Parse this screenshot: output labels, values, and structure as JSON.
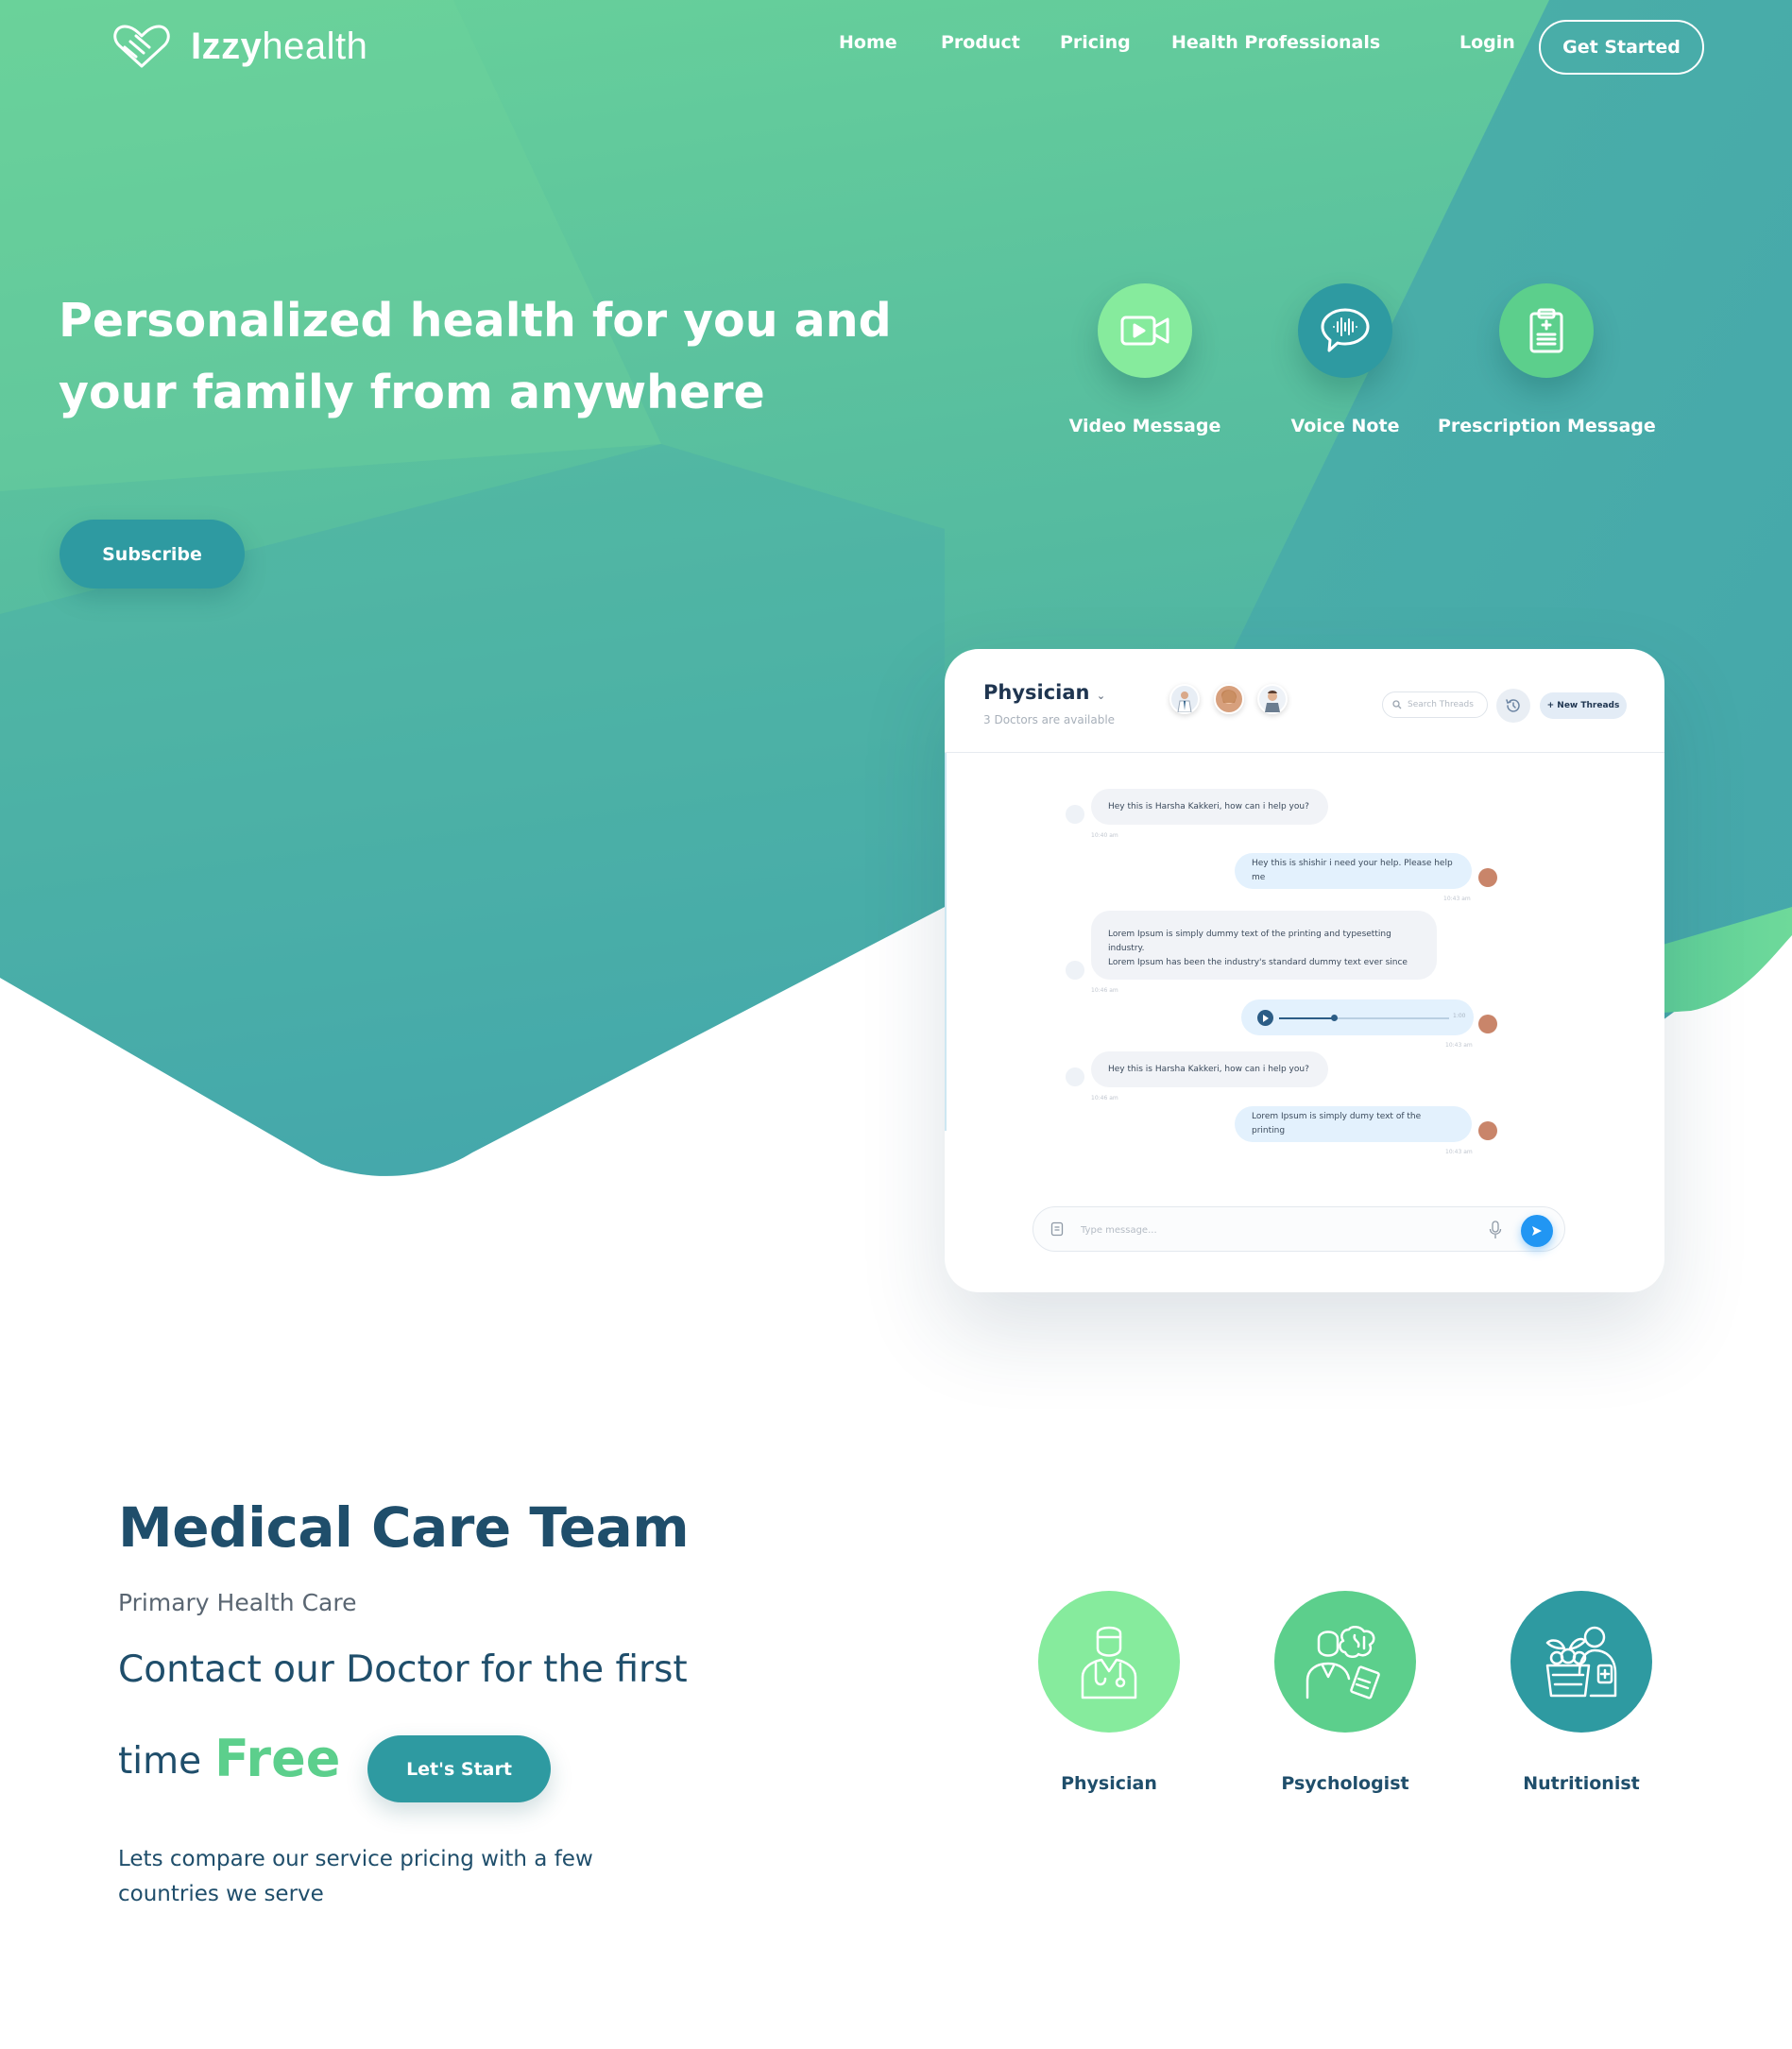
{
  "brand": {
    "name_bold": "Izzy",
    "name_light": "health",
    "logo_icon": "handshake-heart-icon"
  },
  "nav": {
    "links": [
      "Home",
      "Product",
      "Pricing",
      "Health Professionals"
    ],
    "login": "Login",
    "get_started": "Get Started"
  },
  "hero": {
    "title_line1": "Personalized health for you and",
    "title_line2": "your family from anywhere",
    "subscribe": "Subscribe",
    "features": [
      {
        "label": "Video Message",
        "icon": "video-camera-icon",
        "color": "#86eb9d"
      },
      {
        "label": "Voice Note",
        "icon": "voice-chat-bubble-icon",
        "color": "#2e9aa1"
      },
      {
        "label": "Prescription Message",
        "icon": "clipboard-prescription-icon",
        "color": "#5ccf8c"
      }
    ]
  },
  "chat": {
    "title": "Physician",
    "subtitle": "3 Doctors are available",
    "search_placeholder": "Search Threads",
    "new_threads": "+ New Threads",
    "messages": [
      {
        "side": "left",
        "text": "Hey this is Harsha Kakkeri, how can i help you?",
        "time": "10:40 am"
      },
      {
        "side": "right",
        "text": "Hey this is shishir i need your help. Please help me",
        "time": "10:43 am"
      },
      {
        "side": "left",
        "text_line1": "Lorem Ipsum is simply dummy text of the printing and typesetting industry.",
        "text_line2": "Lorem Ipsum has been the industry's standard dummy text ever since",
        "time": "10:46 am"
      },
      {
        "side": "right",
        "type": "audio",
        "progress": 0.32,
        "duration": "1:00",
        "time": "10:43 am"
      },
      {
        "side": "left",
        "text": "Hey this is Harsha Kakkeri, how can i help you?",
        "time": "10:46 am"
      },
      {
        "side": "right",
        "text": "Lorem Ipsum is simply dumy text of the printing",
        "time": "10:43 am"
      }
    ],
    "composer_placeholder": "Type message..."
  },
  "care": {
    "title": "Medical Care Team",
    "subtitle": "Primary Health Care",
    "contact_line": "Contact our Doctor for the first",
    "time_word": "time",
    "free_word": "Free",
    "start_button": "Let's Start",
    "compare_line1": "Lets compare our service pricing with a few",
    "compare_line2": "countries we serve",
    "team": [
      {
        "label": "Physician",
        "icon": "doctor-icon",
        "color": "#86eb9d"
      },
      {
        "label": "Psychologist",
        "icon": "psychologist-brain-icon",
        "color": "#5ccf8c"
      },
      {
        "label": "Nutritionist",
        "icon": "nutritionist-fruit-basket-icon",
        "color": "#2e9aa1"
      }
    ]
  },
  "colors": {
    "hero_green": "#68d19a",
    "hero_teal": "#47a9ab",
    "accent_teal": "#2e9aa1",
    "free_green": "#5ccf8c",
    "navy_text": "#1f4e6b"
  }
}
